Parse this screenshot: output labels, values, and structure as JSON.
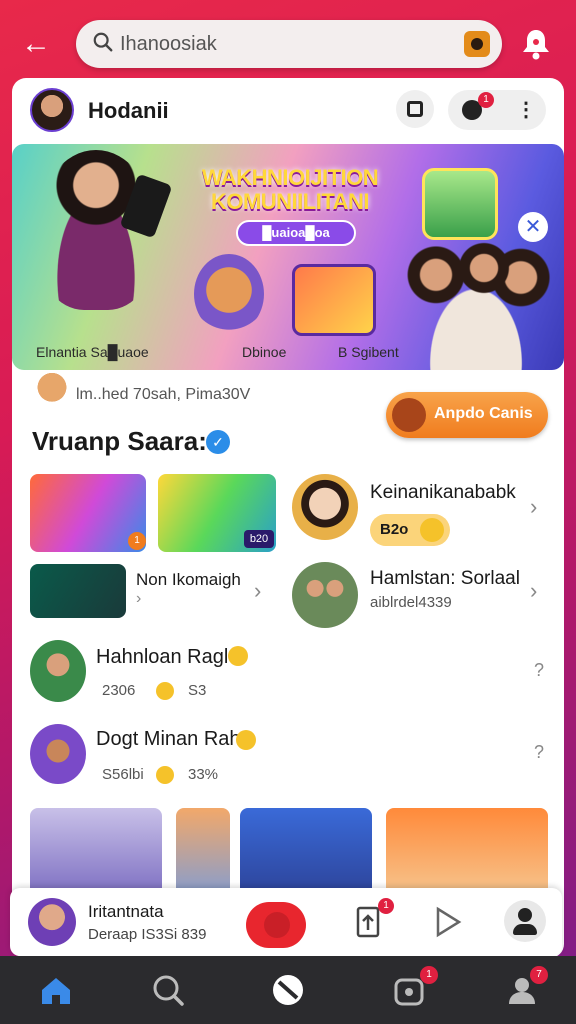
{
  "search": {
    "query": "Ihanoosiak"
  },
  "header": {
    "name": "Hodanii",
    "notif_count": "1"
  },
  "banner": {
    "title": "WAKHNIOIJITION KOMUNIILITANI",
    "chip": "█uaioa█oa",
    "captions": [
      "Elnantia Sa█uaoe",
      "Dbinoe",
      "B Sgibent"
    ]
  },
  "sub_row": {
    "text": "lm..hed 70sah, Pima30V"
  },
  "apply_button": {
    "label": "Anpdo Canis"
  },
  "section": {
    "title": "Vruanp Saara:"
  },
  "items": [
    {
      "title": "Keinanikanababk",
      "tag": "B2o",
      "sub": ""
    },
    {
      "title": "Non Ikomaigh",
      "sub": "",
      "extra": ""
    },
    {
      "title": "Hamlstan: Sorlaal",
      "sub": "aiblrdel4339"
    },
    {
      "title": "Hahnloan Ragl",
      "sub": "2306",
      "count": "S3"
    },
    {
      "title": "Dogt Minan Rahn",
      "sub": "S56lbi",
      "count": "33%"
    }
  ],
  "grid_thumbs": [
    {
      "badge": "1"
    },
    {
      "badge": "b20"
    }
  ],
  "mini_player": {
    "title": "Iritantnata",
    "sub": "Deraap IS3Si 839",
    "badge": "1"
  },
  "nav": {
    "badges": [
      "1",
      "7"
    ]
  },
  "colors": {
    "accent": "#e8294a",
    "orange": "#f07c1e",
    "blue": "#2b8de8",
    "nav_bg": "#2b2b2e"
  }
}
